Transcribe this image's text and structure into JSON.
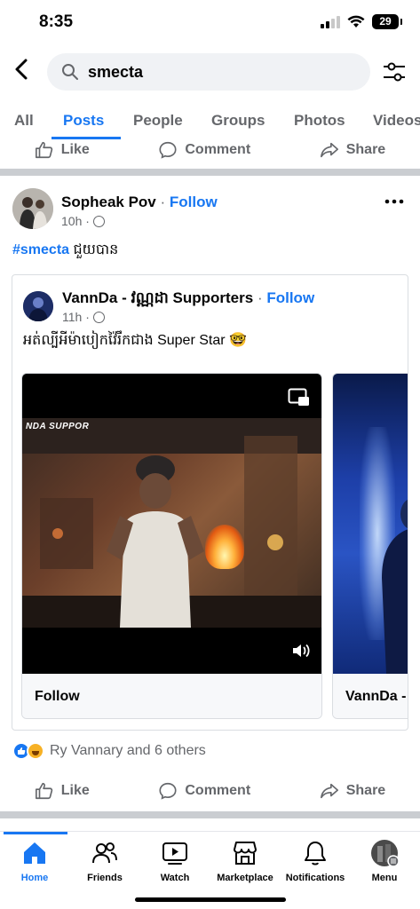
{
  "status": {
    "time": "8:35",
    "battery": "29"
  },
  "search": {
    "query": "smecta"
  },
  "tabs": [
    "All",
    "Posts",
    "People",
    "Groups",
    "Photos",
    "Videos"
  ],
  "actions": {
    "like": "Like",
    "comment": "Comment",
    "share": "Share"
  },
  "post": {
    "author": "Sopheak Pov",
    "separator": "·",
    "follow": "Follow",
    "time": "10h ·",
    "hashtag": "#smecta",
    "text": " ជួយបាន",
    "shared": {
      "author": "VannDa - វណ្ណដា Supporters",
      "separator": "·",
      "follow": "Follow",
      "time": "11h ·",
      "text": "អត់ល្បីអីម៉ាបៀកវ៉ៃរឹកជាង Super Star 🤓",
      "banner": "NDA SUPPOR",
      "media": [
        {
          "footer": "Follow"
        },
        {
          "footer": "VannDa - វ"
        }
      ]
    },
    "reactions": "Ry Vannary and 6 others"
  },
  "nav": [
    {
      "label": "Home",
      "icon": "home-icon"
    },
    {
      "label": "Friends",
      "icon": "friends-icon"
    },
    {
      "label": "Watch",
      "icon": "watch-icon"
    },
    {
      "label": "Marketplace",
      "icon": "marketplace-icon"
    },
    {
      "label": "Notifications",
      "icon": "bell-icon"
    },
    {
      "label": "Menu",
      "icon": "menu-avatar-icon"
    }
  ],
  "colors": {
    "accent": "#1877f2",
    "muted": "#65676b",
    "divider": "#cacdd1"
  }
}
